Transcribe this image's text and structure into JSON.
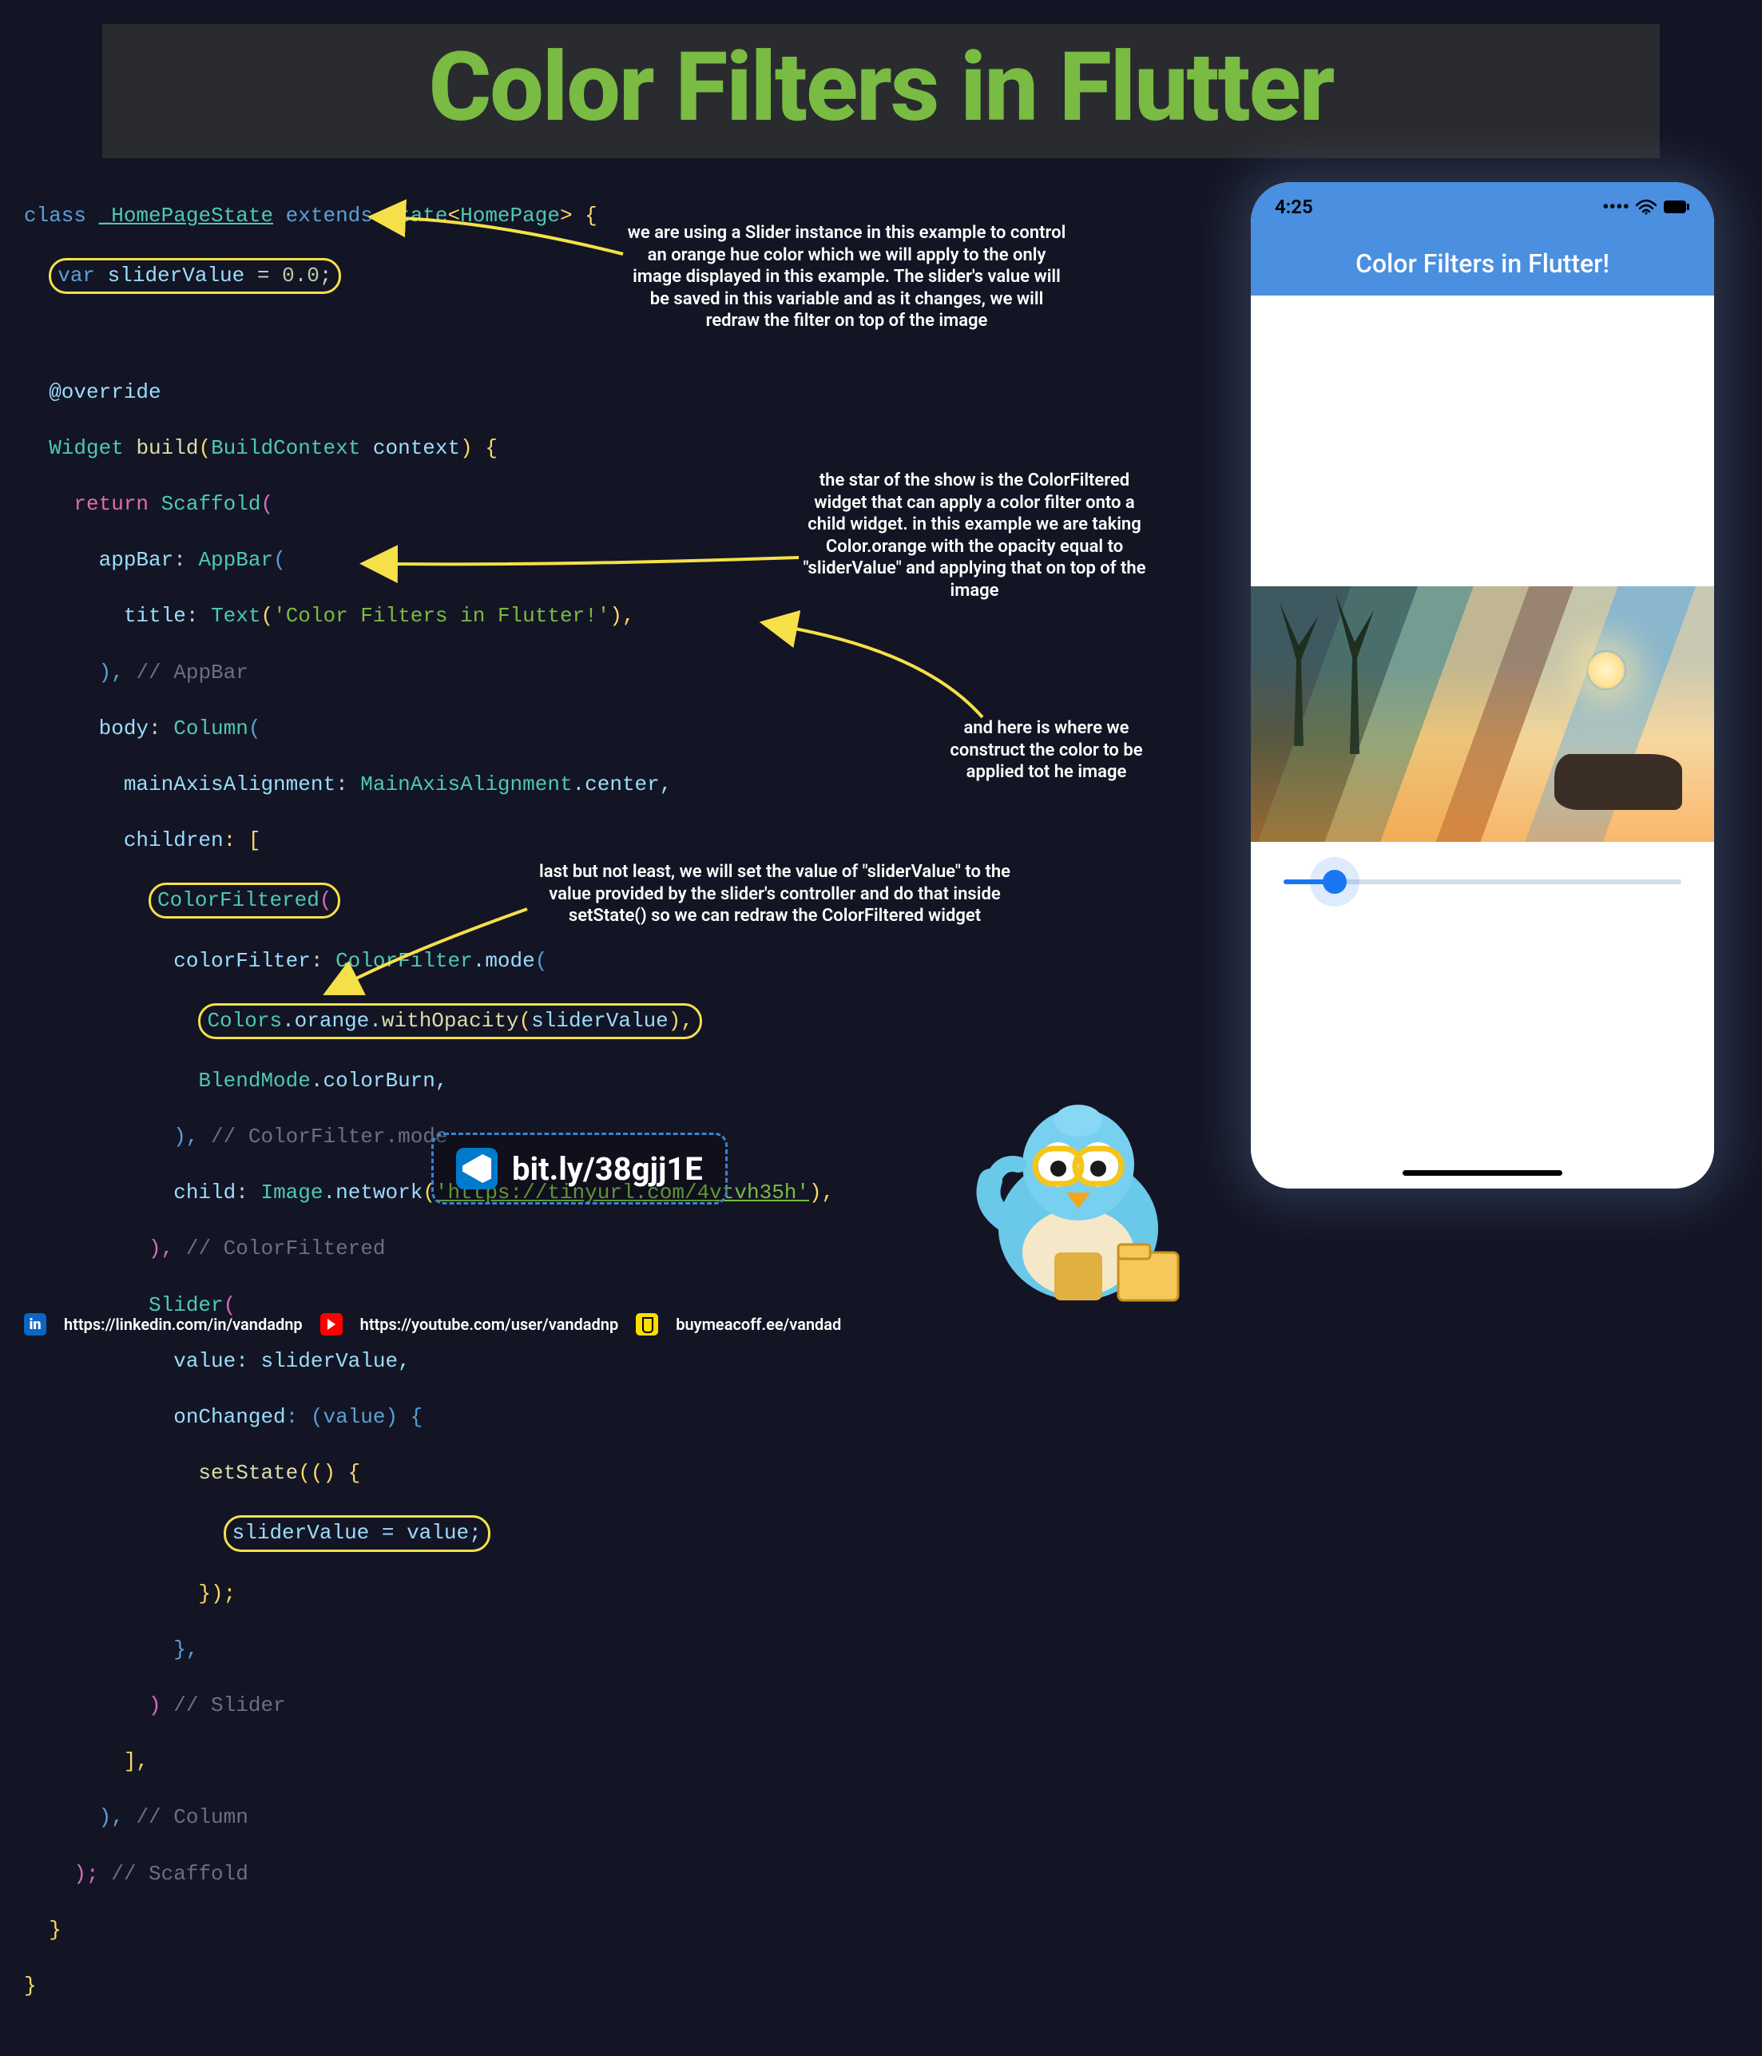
{
  "title": "Color Filters in Flutter",
  "annotations": {
    "a1": "we are using a Slider instance in this example to control an orange hue color which we will apply to the only image displayed in this example. The slider's value will be saved in this variable and as it changes, we will redraw the filter on top of the image",
    "a2": "the star of the show is the ColorFiltered widget that can apply a color filter onto a child widget. in this example we are taking Color.orange with the opacity equal to \"sliderValue\" and applying that on top of the image",
    "a3": "and here is where we construct the color to be applied tot he image",
    "a4": "last but not least, we will set the value of \"sliderValue\" to the value provided by the slider's controller and do that inside setState() so we can redraw the ColorFiltered widget"
  },
  "shortlink": "bit.ly/38gjj1E",
  "phone": {
    "time": "4:25",
    "appbar_title": "Color Filters in Flutter!",
    "slider_value": 0.13
  },
  "code": {
    "c0": "class ",
    "c1": "_HomePageState",
    "c2": " extends ",
    "c3": "State",
    "c4": "<",
    "c5": "HomePage",
    "c6": "> {",
    "c7": "var",
    "c8": " sliderValue ",
    "c9": "= ",
    "c10": "0.0",
    "c11": ";",
    "c12": "  @override",
    "c13": "  Widget ",
    "c14": "build",
    "c15": "(",
    "c16": "BuildContext",
    "c17": " context",
    "c18": ") {",
    "c19": "    return ",
    "c20": "Scaffold",
    "c21": "(",
    "c22": "      appBar",
    "c23": ": ",
    "c24": "AppBar",
    "c25": "(",
    "c26": "        title",
    "c27": "Text",
    "c28": "'Color Filters in Flutter!'",
    "c29": "),",
    "c30": "      ), ",
    "c31": "// AppBar",
    "c32": "      body",
    "c33": "Column",
    "c34": "        mainAxisAlignment",
    "c35": "MainAxisAlignment",
    "c36": ".center,",
    "c37": "        children",
    "c38": ": [",
    "c39": "ColorFiltered",
    "c40": "            colorFilter",
    "c41": "ColorFilter",
    "c42": ".mode",
    "c43": "Colors",
    "c44": ".orange.",
    "c45": "withOpacity",
    "c46": "sliderValue",
    "c47": "              BlendMode",
    "c48": ".colorBurn,",
    "c49": "            ), ",
    "c50": "// ColorFilter.mode",
    "c51": "            child",
    "c52": "Image",
    "c53": ".network",
    "c54": "'https://tinyurl.com/4vtvh35h'",
    "c55": "          ), ",
    "c56": "// ColorFiltered",
    "c57": "          Slider",
    "c58": "            value",
    "c59": ": sliderValue,",
    "c60": "            onChanged",
    "c61": ": (value) {",
    "c62": "              setState",
    "c63": "(() {",
    "c64": "sliderValue = value;",
    "c65": "              });",
    "c66": "            },",
    "c67": "          ) ",
    "c68": "// Slider",
    "c69": "        ],",
    "c70": "      ), ",
    "c71": "// Column",
    "c72": "    ); ",
    "c73": "// Scaffold",
    "c74": "  }",
    "c75": "}"
  },
  "footer": {
    "linkedin": "https://linkedin.com/in/vandadnp",
    "youtube": "https://youtube.com/user/vandadnp",
    "bmc": "buymeacoff.ee/vandad"
  }
}
